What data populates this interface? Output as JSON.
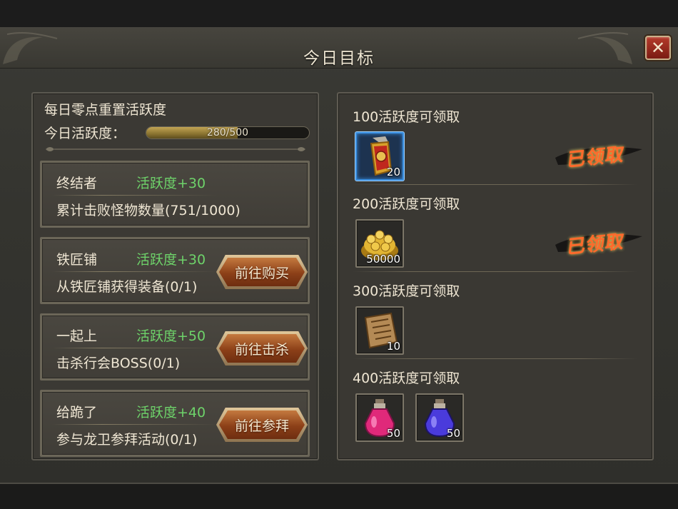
{
  "window": {
    "title": "今日目标",
    "close_label": "✕"
  },
  "summary": {
    "reset_text": "每日零点重置活跃度",
    "active_label": "今日活跃度：",
    "progress_text": "280/500",
    "progress_value": 280,
    "progress_max": 500
  },
  "tasks": [
    {
      "name": "终结者",
      "points": "活跃度+30",
      "desc": "累计击败怪物数量(751/1000)",
      "button": ""
    },
    {
      "name": "铁匠铺",
      "points": "活跃度+30",
      "desc": "从铁匠铺获得装备(0/1)",
      "button": "前往购买"
    },
    {
      "name": "一起上",
      "points": "活跃度+50",
      "desc": "击杀行会BOSS(0/1)",
      "button": "前往击杀"
    },
    {
      "name": "给跪了",
      "points": "活跃度+40",
      "desc": "参与龙卫参拜活动(0/1)",
      "button": "前往参拜"
    }
  ],
  "rewards": [
    {
      "title": "100活跃度可领取",
      "claimed_label": "已领取",
      "items": [
        {
          "icon": "token-icon",
          "count": "20"
        }
      ]
    },
    {
      "title": "200活跃度可领取",
      "claimed_label": "已领取",
      "items": [
        {
          "icon": "gold-coins-icon",
          "count": "50000"
        }
      ]
    },
    {
      "title": "300活跃度可领取",
      "claimed_label": "",
      "items": [
        {
          "icon": "scroll-icon",
          "count": "10"
        }
      ]
    },
    {
      "title": "400活跃度可领取",
      "claimed_label": "",
      "items": [
        {
          "icon": "red-potion-icon",
          "count": "50"
        },
        {
          "icon": "blue-potion-icon",
          "count": "50"
        }
      ]
    }
  ],
  "colors": {
    "points_green": "#6ed36a",
    "selected_blue": "#3a8fe0",
    "stamp_orange": "#ff6a2c"
  }
}
